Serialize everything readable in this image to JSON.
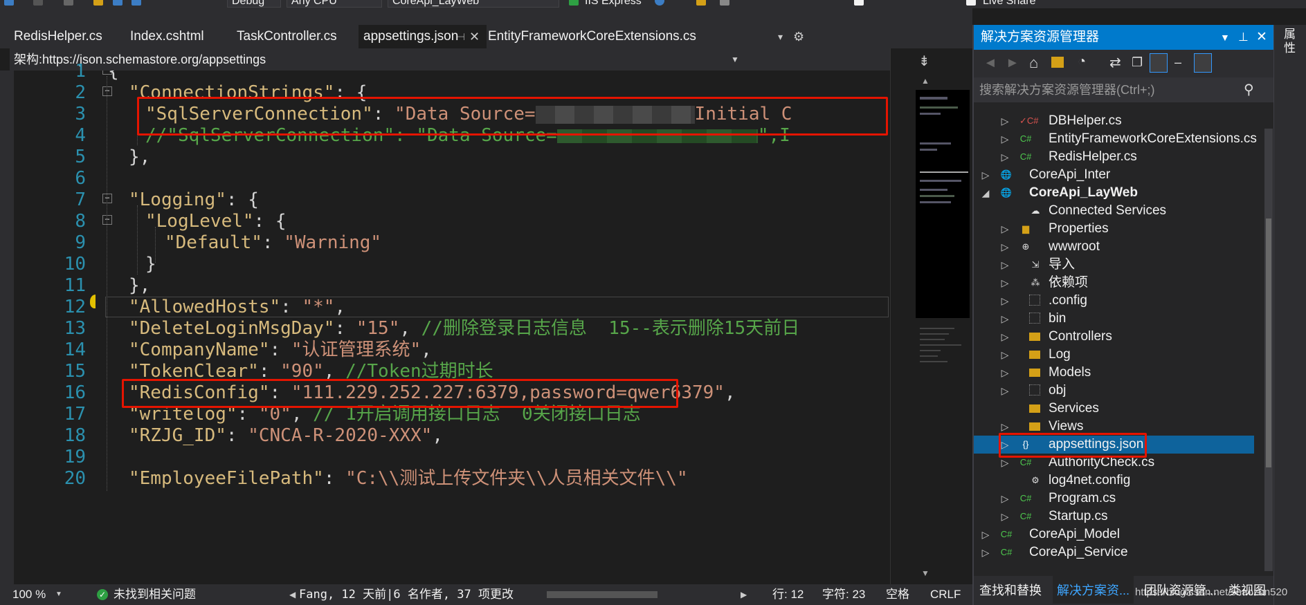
{
  "toolbar": {
    "config": "Debug",
    "platform": "Any CPU",
    "startup_project": "CoreApi_LayWeb",
    "run_target": "IIS Express",
    "live_share": "Live Share"
  },
  "tabs": [
    {
      "label": "RedisHelper.cs"
    },
    {
      "label": "Index.cshtml"
    },
    {
      "label": "TaskController.cs"
    },
    {
      "label": "appsettings.json",
      "active": true
    },
    {
      "label": "EntityFrameworkCoreExtensions.cs"
    }
  ],
  "schema": {
    "label": "架构:",
    "url": "https://json.schemastore.org/appsettings"
  },
  "editor": {
    "lines": [
      {
        "n": "1"
      },
      {
        "n": "2"
      },
      {
        "n": "3"
      },
      {
        "n": "4"
      },
      {
        "n": "5"
      },
      {
        "n": "6"
      },
      {
        "n": "7"
      },
      {
        "n": "8"
      },
      {
        "n": "9"
      },
      {
        "n": "10"
      },
      {
        "n": "11"
      },
      {
        "n": "12"
      },
      {
        "n": "13"
      },
      {
        "n": "14"
      },
      {
        "n": "15"
      },
      {
        "n": "16"
      },
      {
        "n": "17"
      },
      {
        "n": "18"
      },
      {
        "n": "19"
      },
      {
        "n": "20"
      }
    ],
    "code": {
      "l1": "{",
      "l2_key": "\"ConnectionStrings\"",
      "l2_rest": ": {",
      "l3_key": "\"SqlServerConnection\"",
      "l3_sep": ": ",
      "l3_val": "\"Data Source=",
      "l3_val2": "Initial C",
      "l4": "//\"SqlServerConnection\": \"Data Source=",
      "l4_tail": "\",I",
      "l5": "},",
      "l7_key": "\"Logging\"",
      "l7_rest": ": {",
      "l8_key": "\"LogLevel\"",
      "l8_rest": ": {",
      "l9_key": "\"Default\"",
      "l9_sep": ": ",
      "l9_val": "\"Warning\"",
      "l10": "}",
      "l11": "},",
      "l12_key": "\"AllowedHosts\"",
      "l12_sep": ": ",
      "l12_val": "\"*\"",
      "l12_end": ",",
      "l13_key": "\"DeleteLoginMsgDay\"",
      "l13_sep": ": ",
      "l13_val": "\"15\"",
      "l13_end": ", ",
      "l13_comment": "//删除登录日志信息  15--表示删除15天前日",
      "l14_key": "\"CompanyName\"",
      "l14_sep": ": ",
      "l14_val": "\"认证管理系统\"",
      "l14_end": ",",
      "l15_key": "\"TokenClear\"",
      "l15_sep": ": ",
      "l15_val": "\"90\"",
      "l15_end": ", ",
      "l15_comment": "//Token过期时长",
      "l16_key": "\"RedisConfig\"",
      "l16_sep": ": ",
      "l16_val": "\"111.229.252.227:6379,password=qwer6379\"",
      "l16_end": ",",
      "l17_key": "\"writelog\"",
      "l17_sep": ": ",
      "l17_val": "\"0\"",
      "l17_end": ", ",
      "l17_comment": "// 1开启调用接口日志  0关闭接口日志",
      "l18_key": "\"RZJG_ID\"",
      "l18_sep": ": ",
      "l18_val": "\"CNCA-R-2020-XXX\"",
      "l18_end": ",",
      "l20_key": "\"EmployeeFilePath\"",
      "l20_sep": ": ",
      "l20_val": "\"C:\\\\测试上传文件夹\\\\人员相关文件\\\\\""
    }
  },
  "status": {
    "zoom": "100 %",
    "issues": "未找到相关问题",
    "git": "Fang, 12 天前|6 名作者, 37 项更改",
    "line": "行: 12",
    "char": "字符: 23",
    "space": "空格",
    "eol": "CRLF"
  },
  "solution_explorer": {
    "title": "解决方案资源管理器",
    "search_placeholder": "搜索解决方案资源管理器(Ctrl+;)",
    "items": [
      {
        "label": "DBHelper.cs"
      },
      {
        "label": "EntityFrameworkCoreExtensions.cs"
      },
      {
        "label": "RedisHelper.cs"
      },
      {
        "label": "CoreApi_Inter"
      },
      {
        "label": "CoreApi_LayWeb"
      },
      {
        "label": "Connected Services"
      },
      {
        "label": "Properties"
      },
      {
        "label": "wwwroot"
      },
      {
        "label": "导入"
      },
      {
        "label": "依赖项"
      },
      {
        "label": ".config"
      },
      {
        "label": "bin"
      },
      {
        "label": "Controllers"
      },
      {
        "label": "Log"
      },
      {
        "label": "Models"
      },
      {
        "label": "obj"
      },
      {
        "label": "Services"
      },
      {
        "label": "Views"
      },
      {
        "label": "appsettings.json"
      },
      {
        "label": "AuthorityCheck.cs"
      },
      {
        "label": "log4net.config"
      },
      {
        "label": "Program.cs"
      },
      {
        "label": "Startup.cs"
      },
      {
        "label": "CoreApi_Model"
      },
      {
        "label": "CoreApi_Service"
      }
    ],
    "bottom_tabs": [
      "查找和替换",
      "解决方案资...",
      "团队资源管...",
      "类视图"
    ]
  },
  "right_strip": {
    "label": "属性"
  },
  "watermark": "https://blog.csdn.net/shaozun520",
  "colors": {
    "accent": "#007acc",
    "highlight": "#e51400",
    "key": "#d7ba7d",
    "string": "#ce9178",
    "comment": "#57a64a"
  }
}
